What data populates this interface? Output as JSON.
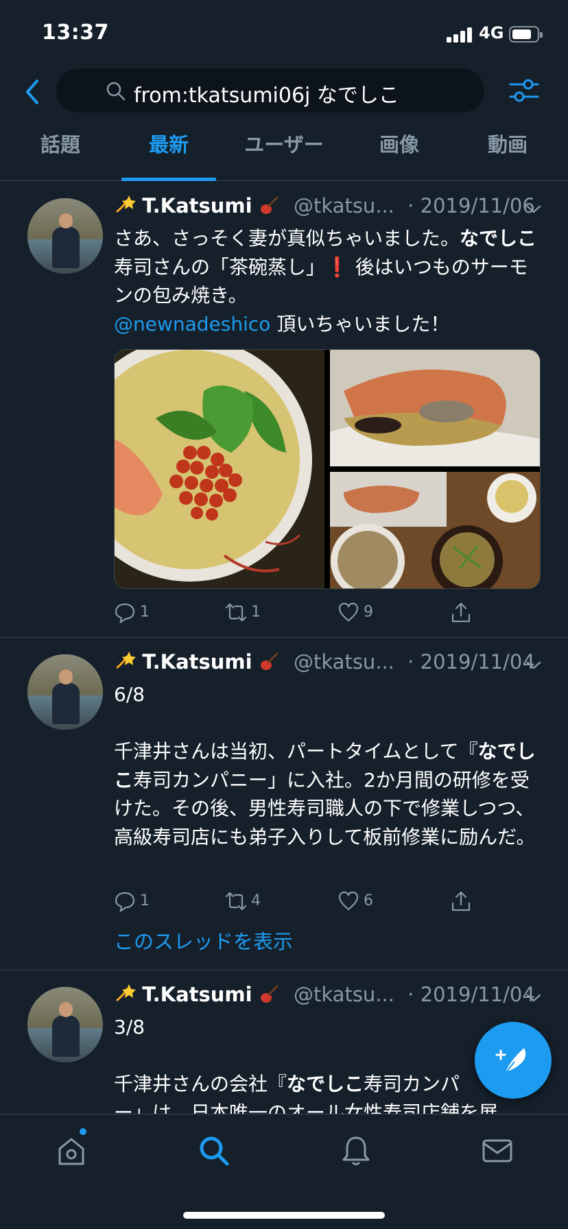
{
  "status": {
    "time": "13:37",
    "network": "4G"
  },
  "search": {
    "query": "from:tkatsumi06j なでしこ"
  },
  "tabs": [
    {
      "label": "話題"
    },
    {
      "label": "最新"
    },
    {
      "label": "ユーザー"
    },
    {
      "label": "画像"
    },
    {
      "label": "動画"
    }
  ],
  "active_tab": "最新",
  "tweets": [
    {
      "name": "T.Katsumi",
      "handle": "@tkatsu...",
      "date": "· 2019/11/06",
      "text_parts": [
        "さあ、さっそく妻が真似ちゃいました。",
        "なでしこ",
        "寿司さんの「茶碗蒸し」",
        "❗",
        " 後はいつものサーモンの包み焼き。"
      ],
      "mention": "@newnadeshico",
      "mention_after": " 頂いちゃいました！",
      "replies": "1",
      "retweets": "1",
      "likes": "9"
    },
    {
      "name": "T.Katsumi",
      "handle": "@tkatsu...",
      "date": "· 2019/11/04",
      "line1": "6/8",
      "text_parts": [
        "千津井さんは当初、パートタイムとして『",
        "なでしこ",
        "寿司カンパニー」に入社。2か月間の研修を受けた。その後、男性寿司職人の下で修業しつつ、高級寿司店にも弟子入りして板前修業に励んだ。"
      ],
      "replies": "1",
      "retweets": "4",
      "likes": "6",
      "thread_link": "このスレッドを表示"
    },
    {
      "name": "T.Katsumi",
      "handle": "@tkatsu...",
      "date": "· 2019/11/04",
      "line1": "3/8",
      "text_parts": [
        "千津井さんの会社『",
        "なでしこ",
        "寿司カンパ",
        "ー」は、日本唯一のオール女性寿司店舗を展"
      ]
    }
  ],
  "icons": {
    "back": "chevron-left-icon",
    "search": "magnifier-icon",
    "filter": "sliders-icon",
    "compose": "compose-feather-icon",
    "home": "home-icon",
    "explore": "search-icon",
    "notifications": "bell-icon",
    "messages": "mail-icon"
  },
  "colors": {
    "background": "#15202b",
    "accent": "#1d9bf0",
    "muted": "#8899a6",
    "divider": "#38444d"
  }
}
